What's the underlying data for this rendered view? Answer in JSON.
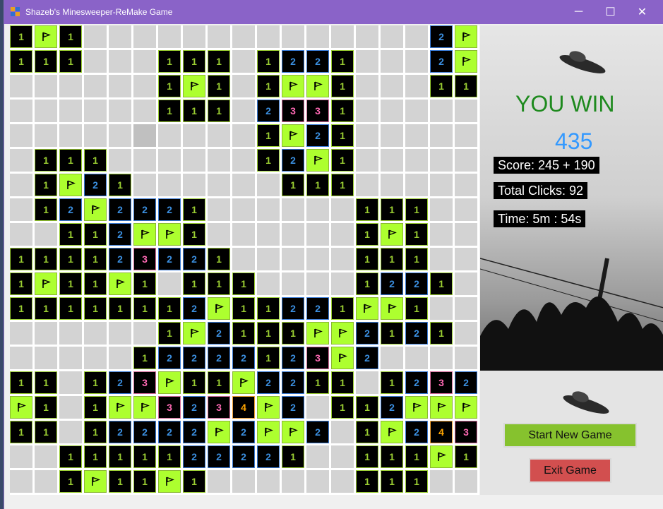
{
  "window": {
    "title": "Shazeb's Minesweeper-ReMake Game",
    "controls": {
      "minimize": "─",
      "maximize": "☐",
      "close": "✕"
    }
  },
  "colors": {
    "titlebar": "#8a63c8",
    "unrevealed": "#d3d3d3",
    "number_cell": "#000000",
    "flag_cell": "#adff2f",
    "n1": "#9acd32",
    "n2": "#3b8fe0",
    "n3": "#ff69b4",
    "n4": "#ffa500",
    "win_text": "#1e8a1e",
    "total_text": "#3399ff",
    "start_button": "#86c22e",
    "exit_button": "#d24f4f"
  },
  "board": {
    "rows": 19,
    "cols": 19,
    "legend": {
      ".": "unrevealed",
      "H": "hover",
      "F": "flag",
      "1": "one",
      "2": "two",
      "3": "three",
      "4": "four"
    },
    "grid": [
      "1F1..........2F",
      "111..111.1221..2F",
      ".....1F1.1FF1..11",
      ".....111.2331....",
      "..........1F21...",
      ".111......12F1...",
      ".1F21......111...",
      ".12F2221.....111.",
      "..112FF1.....1F1.",
      "111123 21.....111.",
      "1F11F1.111....1221",
      "11111112F11221FF1",
      "......1F2111FF2121",
      ".....12222123F2...",
      "11.123F11F2211.1232",
      "F1.1FF3234F2.112FFF",
      "11.12222F2FF2.1F2343",
      "..1111122221..1111F1",
      "..1F11F1.......111"
    ]
  },
  "status": {
    "result": "YOU WIN",
    "total": "435",
    "score": "Score: 245 + 190",
    "clicks": "Total Clicks: 92",
    "time": "Time: 5m : 54s"
  },
  "buttons": {
    "start": "Start New Game",
    "exit": "Exit Game"
  }
}
